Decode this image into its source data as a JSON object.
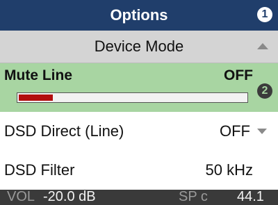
{
  "header": {
    "title": "Options",
    "badge": "1"
  },
  "submenu": {
    "label": "Device Mode",
    "arrow_icon": "up-arrow-icon"
  },
  "selected_item": {
    "label": "Mute Line",
    "value": "OFF",
    "badge": "2",
    "level_fraction": 0.15
  },
  "items": [
    {
      "label": "DSD Direct (Line)",
      "value": "OFF",
      "arrow_icon": "down-arrow-icon"
    },
    {
      "label": "DSD Filter",
      "value": "50 kHz"
    }
  ],
  "status": {
    "vol_label": "VOL",
    "vol_value": "-20.0 dB",
    "sp_label": "SP c",
    "rate": "44.1"
  },
  "colors": {
    "title_bg": "#203e6b",
    "selected_bg": "#a8d5a2",
    "level_fill": "#b20e0e",
    "submenu_bg": "#d4d4d4",
    "status_bg": "#3a3a3a"
  }
}
